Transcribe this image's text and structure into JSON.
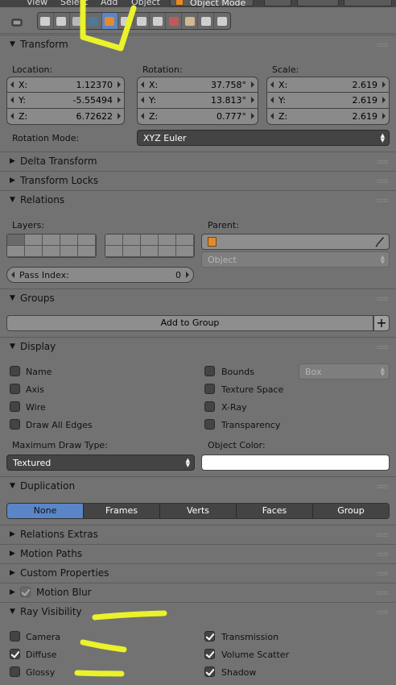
{
  "top_menu": {
    "view": "View",
    "select": "Select",
    "add": "Add",
    "object": "Object",
    "mode": "Object Mode"
  },
  "tabs": [
    {
      "name": "render-tab",
      "color": "#cfcfcf"
    },
    {
      "name": "render-layers-tab",
      "color": "#cfcfcf"
    },
    {
      "name": "scene-tab",
      "color": "#b8b8b8"
    },
    {
      "name": "world-tab",
      "color": "#4b7a9a"
    },
    {
      "name": "object-tab",
      "color": "#e48a2a",
      "active": true
    },
    {
      "name": "constraints-tab",
      "color": "#cfcfcf"
    },
    {
      "name": "modifiers-tab",
      "color": "#cfcfcf"
    },
    {
      "name": "data-tab",
      "color": "#cfcfcf"
    },
    {
      "name": "material-tab",
      "color": "#c05a5a"
    },
    {
      "name": "texture-tab",
      "color": "#d0b890"
    },
    {
      "name": "particles-tab",
      "color": "#cfcfcf"
    },
    {
      "name": "physics-tab",
      "color": "#cfcfcf"
    }
  ],
  "transform": {
    "title": "Transform",
    "location_label": "Location:",
    "rotation_label": "Rotation:",
    "scale_label": "Scale:",
    "location": [
      {
        "axis": "X:",
        "value": "1.12370"
      },
      {
        "axis": "Y:",
        "value": "-5.55494"
      },
      {
        "axis": "Z:",
        "value": "6.72622"
      }
    ],
    "rotation": [
      {
        "axis": "X:",
        "value": "37.758°"
      },
      {
        "axis": "Y:",
        "value": "13.813°"
      },
      {
        "axis": "Z:",
        "value": "0.777°"
      }
    ],
    "scale": [
      {
        "axis": "X:",
        "value": "2.619"
      },
      {
        "axis": "Y:",
        "value": "2.619"
      },
      {
        "axis": "Z:",
        "value": "2.619"
      }
    ],
    "rotation_mode_label": "Rotation Mode:",
    "rotation_mode_value": "XYZ Euler"
  },
  "delta_transform": {
    "title": "Delta Transform"
  },
  "transform_locks": {
    "title": "Transform Locks"
  },
  "relations": {
    "title": "Relations",
    "layers_label": "Layers:",
    "parent_label": "Parent:",
    "parent_type": "Object",
    "pass_index_label": "Pass Index:",
    "pass_index_value": "0"
  },
  "groups": {
    "title": "Groups",
    "add_to_group": "Add to Group"
  },
  "display": {
    "title": "Display",
    "name": "Name",
    "axis": "Axis",
    "wire": "Wire",
    "draw_all_edges": "Draw All Edges",
    "bounds": "Bounds",
    "bounds_type": "Box",
    "texture_space": "Texture Space",
    "xray": "X-Ray",
    "transparency": "Transparency",
    "max_draw_type_label": "Maximum Draw Type:",
    "max_draw_type_value": "Textured",
    "object_color_label": "Object Color:",
    "object_color": "#ffffff"
  },
  "duplication": {
    "title": "Duplication",
    "options": [
      "None",
      "Frames",
      "Verts",
      "Faces",
      "Group"
    ],
    "selected": "None"
  },
  "relations_extras": {
    "title": "Relations Extras"
  },
  "motion_paths": {
    "title": "Motion Paths"
  },
  "custom_properties": {
    "title": "Custom Properties"
  },
  "motion_blur": {
    "title": "Motion Blur"
  },
  "ray_visibility": {
    "title": "Ray Visibility",
    "camera": "Camera",
    "diffuse": "Diffuse",
    "glossy": "Glossy",
    "transmission": "Transmission",
    "volume_scatter": "Volume Scatter",
    "shadow": "Shadow"
  },
  "colors": {
    "accent": "#5a86c8",
    "highlighter": "#eaf22a",
    "panel_bg": "#727272"
  }
}
